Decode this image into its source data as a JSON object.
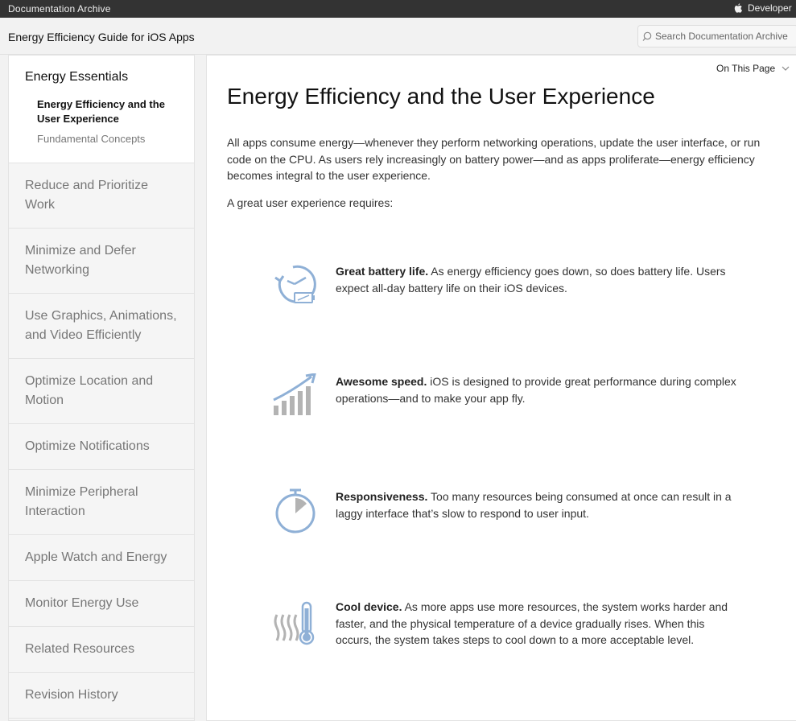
{
  "topbar": {
    "archive": "Documentation Archive",
    "developer": "Developer"
  },
  "header": {
    "guide_title": "Energy Efficiency Guide for iOS Apps",
    "search_placeholder": "Search Documentation Archive"
  },
  "sidebar": {
    "active_section": "Energy Essentials",
    "active_subitems": [
      "Energy Efficiency and the User Experience",
      "Fundamental Concepts"
    ],
    "items": [
      "Reduce and Prioritize Work",
      "Minimize and Defer Networking",
      "Use Graphics, Animations, and Video Efficiently",
      "Optimize Location and Motion",
      "Optimize Notifications",
      "Minimize Peripheral Interaction",
      "Apple Watch and Energy",
      "Monitor Energy Use",
      "Related Resources",
      "Revision History"
    ]
  },
  "main": {
    "on_this_page": "On This Page",
    "title": "Energy Efficiency and the User Experience",
    "intro": "All apps consume energy—whenever they perform networking operations, update the user interface, or run code on the CPU. As users rely increasingly on battery power—and as apps proliferate—energy efficiency becomes integral to the user experience.",
    "requires": "A great user experience requires:",
    "features": [
      {
        "icon": "battery-clock-icon",
        "title": "Great battery life.",
        "text": " As energy efficiency goes down, so does battery life. Users expect all-day battery life on their iOS devices."
      },
      {
        "icon": "speed-chart-icon",
        "title": "Awesome speed.",
        "text": " iOS is designed to provide great performance during complex operations—and to make your app fly."
      },
      {
        "icon": "stopwatch-icon",
        "title": "Responsiveness.",
        "text": " Too many resources being consumed at once can result in a laggy interface that’s slow to respond to user input."
      },
      {
        "icon": "thermometer-icon",
        "title": "Cool device.",
        "text": " As more apps use more resources, the system works harder and faster, and the physical temperature of a device gradually rises. When this occurs, the system takes steps to cool down to a more acceptable level."
      }
    ]
  }
}
